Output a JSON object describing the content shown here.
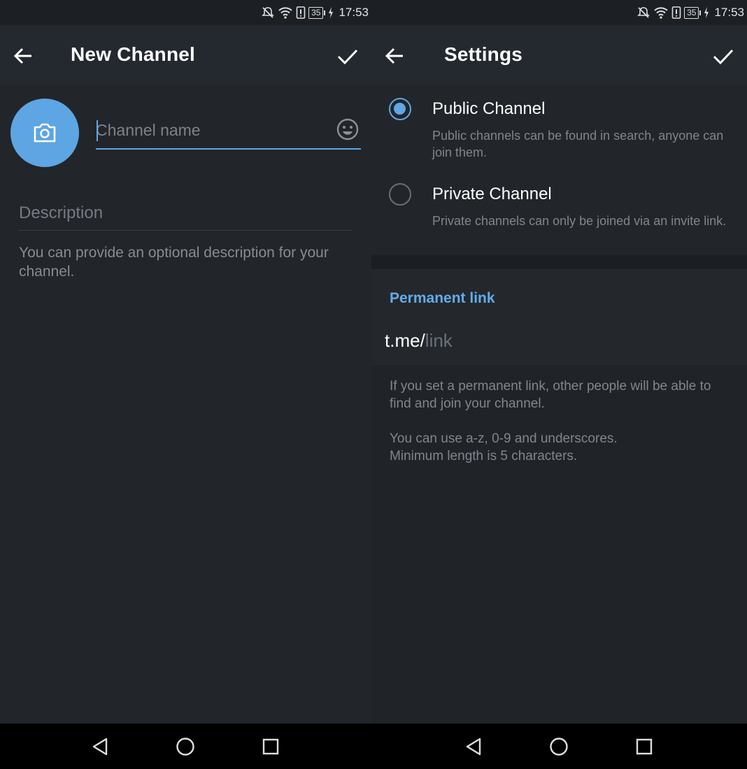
{
  "status_bar": {
    "time": "17:53",
    "battery_level": "35",
    "icons": [
      "mute-icon",
      "wifi-icon",
      "alert-icon",
      "battery-icon",
      "charging-icon"
    ]
  },
  "new_channel": {
    "title": "New Channel",
    "name_placeholder": "Channel name",
    "description_placeholder": "Description",
    "description_hint": "You can provide an optional description for your channel.",
    "icons": {
      "back": "arrow-left-icon",
      "done": "checkmark-icon",
      "avatar": "camera-icon",
      "emoji": "smiley-icon"
    }
  },
  "settings": {
    "title": "Settings",
    "options": [
      {
        "title": "Public Channel",
        "description": "Public channels can be found in search, anyone can join them.",
        "selected": true
      },
      {
        "title": "Private Channel",
        "description": "Private channels can only be joined via an invite link.",
        "selected": false
      }
    ],
    "permanent_link_header": "Permanent link",
    "link_prefix": "t.me/",
    "link_placeholder": "link",
    "info_1": "If you set a permanent link, other people will be able to find and join your channel.",
    "info_2a": "You can use a-z, 0-9 and underscores.",
    "info_2b": "Minimum length is 5 characters."
  },
  "nav_bar": {
    "icons": [
      "back-triangle-icon",
      "home-circle-icon",
      "recents-square-icon"
    ]
  },
  "colors": {
    "accent": "#5fa7e6",
    "avatar": "#5da6e3",
    "app_bar": "#24292f",
    "background": "#22252a",
    "section_header": "#62ace9"
  }
}
